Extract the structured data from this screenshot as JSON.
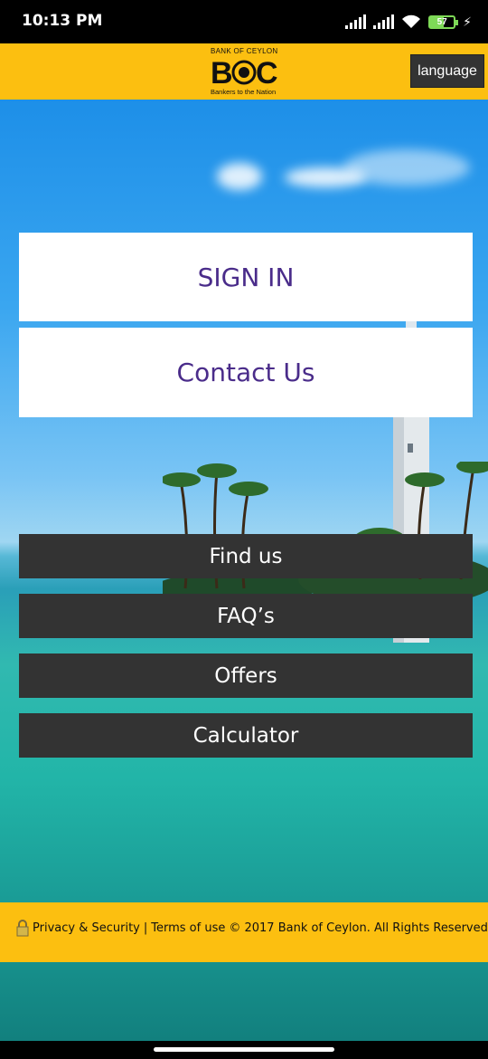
{
  "status_bar": {
    "time": "10:13 PM",
    "battery": "57",
    "icons": [
      "signal-icon",
      "signal-icon",
      "wifi-icon",
      "battery-icon",
      "charging-icon"
    ]
  },
  "header": {
    "logo_top": "BANK OF CEYLON",
    "logo_letters": "BOC",
    "logo_tagline": "Bankers to the Nation",
    "language_label": "language",
    "brand_color": "#fcbf10"
  },
  "main": {
    "sign_in_label": "SIGN IN",
    "contact_label": "Contact Us",
    "find_us_label": "Find us",
    "faq_label": "FAQ’s",
    "offers_label": "Offers",
    "calculator_label": "Calculator",
    "primary_text_color": "#4a2c8a",
    "dark_button_color": "#333333"
  },
  "footer": {
    "privacy_label": "Privacy & Security",
    "separator": "|",
    "terms_label": "Terms of use",
    "copyright": "© 2017 Bank of Ceylon. All Rights Reserved."
  }
}
